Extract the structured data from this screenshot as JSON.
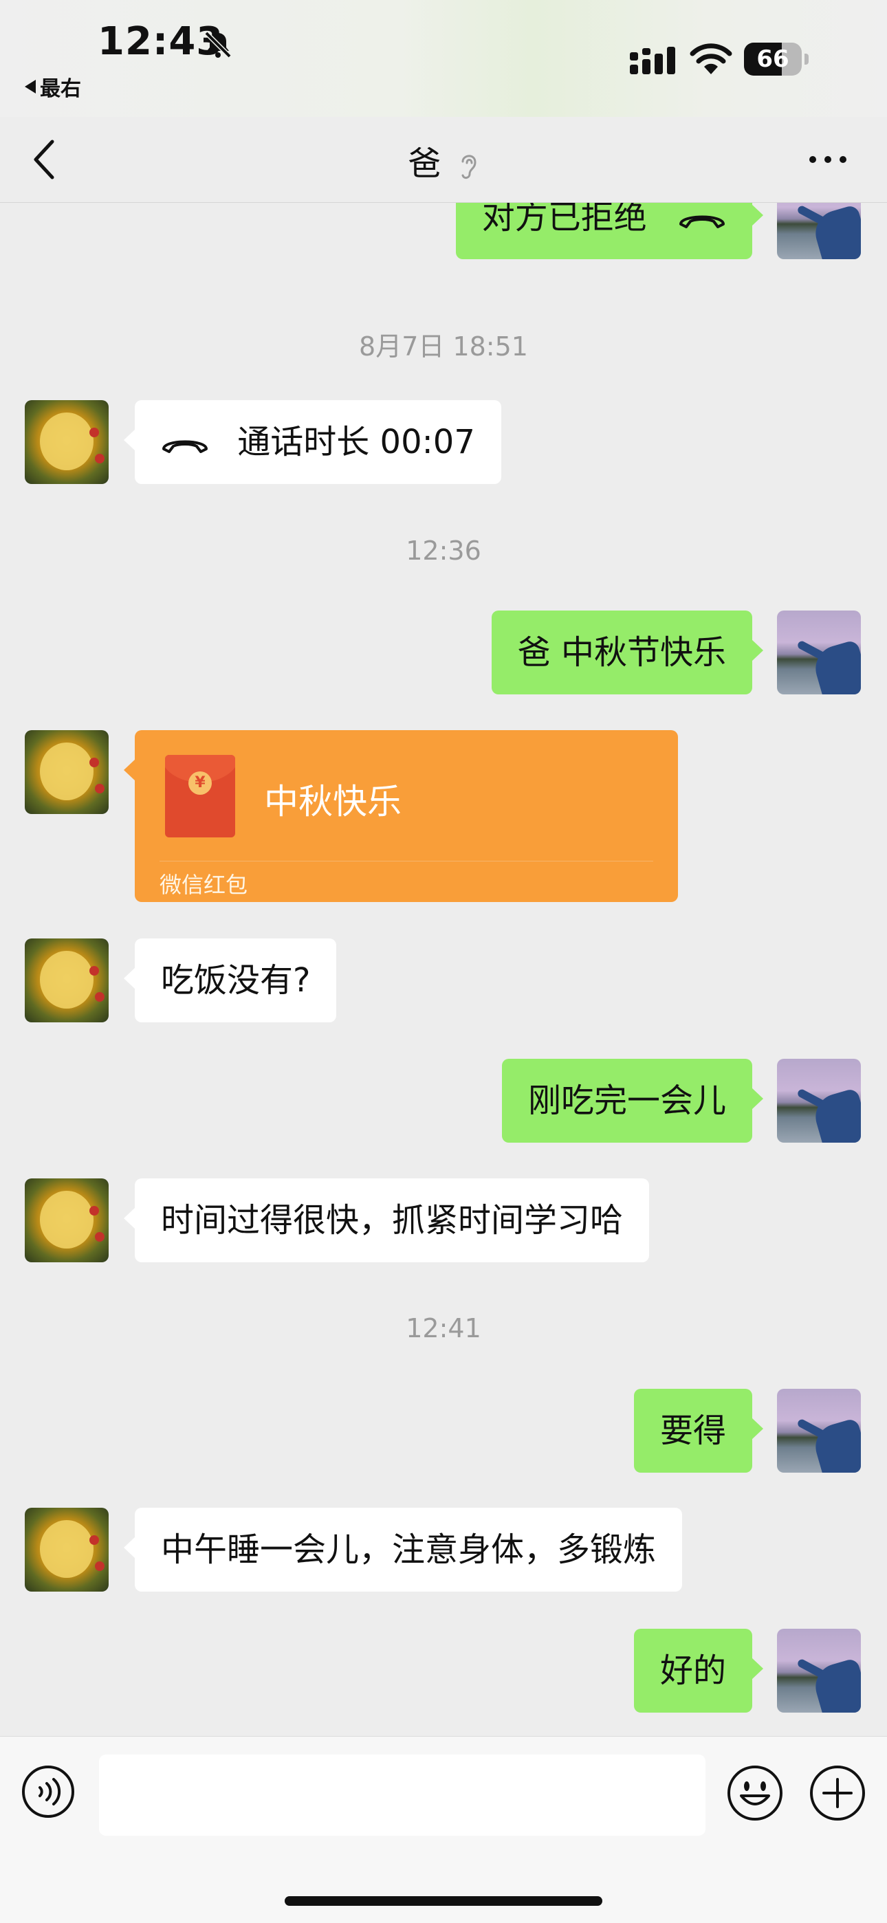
{
  "status": {
    "time": "12:43",
    "back_app": "最右",
    "battery_pct": "66",
    "battery_level": 66
  },
  "nav": {
    "title": "爸"
  },
  "messages": [
    {
      "side": "right",
      "type": "call",
      "text": "对方已拒绝"
    },
    {
      "type": "timestamp",
      "text": "8月7日 18:51"
    },
    {
      "side": "left",
      "type": "call",
      "text": "通话时长 00:07"
    },
    {
      "type": "timestamp",
      "text": "12:36"
    },
    {
      "side": "right",
      "type": "text",
      "text": "爸 中秋节快乐"
    },
    {
      "side": "left",
      "type": "red_packet",
      "title": "中秋快乐",
      "label": "微信红包"
    },
    {
      "side": "left",
      "type": "text",
      "text": "吃饭没有?"
    },
    {
      "side": "right",
      "type": "text",
      "text": "刚吃完一会儿"
    },
    {
      "side": "left",
      "type": "text",
      "text": "时间过得很快，抓紧时间学习哈"
    },
    {
      "type": "timestamp",
      "text": "12:41"
    },
    {
      "side": "right",
      "type": "text",
      "text": "要得"
    },
    {
      "side": "left",
      "type": "text",
      "text": "中午睡一会儿，注意身体，多锻炼"
    },
    {
      "side": "right",
      "type": "text",
      "text": "好的"
    }
  ],
  "input": {
    "value": "",
    "placeholder": ""
  },
  "colors": {
    "outgoing_bubble": "#95EC69",
    "incoming_bubble": "#FFFFFF",
    "red_packet": "#F99E39",
    "background": "#EDEDED"
  },
  "icons": {
    "voice": "voice-icon",
    "emoji": "emoji-icon",
    "plus": "plus-icon",
    "more": "more-icon",
    "back": "back-icon",
    "mute": "bell-slash-icon",
    "ear": "ear-icon",
    "call": "phone-hangup-icon"
  }
}
